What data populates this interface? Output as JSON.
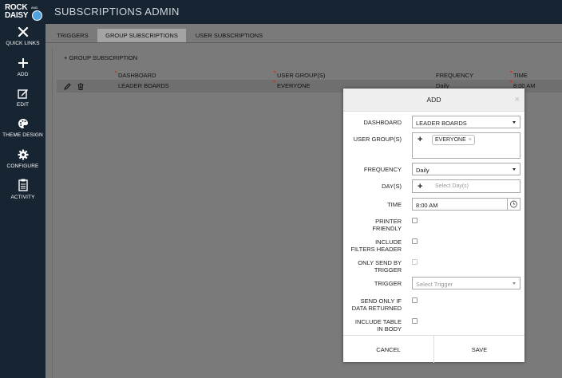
{
  "brand": {
    "line1": "ROCK",
    "line2": "DAISY",
    "and": "AND"
  },
  "header": {
    "title": "SUBSCRIPTIONS ADMIN"
  },
  "sidebar": {
    "items": [
      {
        "label": "QUICK LINKS",
        "icon": "wrench-screwdriver-icon"
      },
      {
        "label": "ADD",
        "icon": "plus-icon"
      },
      {
        "label": "EDIT",
        "icon": "pencil-square-icon"
      },
      {
        "label": "THEME DESIGN",
        "icon": "palette-icon"
      },
      {
        "label": "CONFIGURE",
        "icon": "gear-icon"
      },
      {
        "label": "ACTIVITY",
        "icon": "clipboard-icon"
      }
    ]
  },
  "tabs": [
    {
      "label": "TRIGGERS",
      "active": false
    },
    {
      "label": "GROUP SUBSCRIPTIONS",
      "active": true
    },
    {
      "label": "USER SUBSCRIPTIONS",
      "active": false
    }
  ],
  "panel": {
    "add_label": "+ GROUP SUBSCRIPTION",
    "columns": [
      "DASHBOARD",
      "USER GROUP(S)",
      "FREQUENCY",
      "TIME"
    ],
    "rows": [
      {
        "dashboard": "LEADER BOARDS",
        "user_groups": "EVERYONE",
        "frequency": "Daily",
        "time": "8:00 AM"
      }
    ]
  },
  "modal": {
    "title": "ADD",
    "close": "×",
    "fields": {
      "dashboard": {
        "label": "DASHBOARD",
        "value": "LEADER BOARDS"
      },
      "user_groups": {
        "label": "USER GROUP(S)",
        "chip": "EVERYONE",
        "add": "+"
      },
      "frequency": {
        "label": "FREQUENCY",
        "value": "Daily"
      },
      "days": {
        "label": "DAY(S)",
        "placeholder": "Select Day(s)",
        "add": "+"
      },
      "time": {
        "label": "TIME",
        "value": "8:00 AM"
      },
      "printer_friendly": {
        "label_lines": [
          "PRINTER",
          "FRIENDLY"
        ]
      },
      "include_filters_header": {
        "label_lines": [
          "INCLUDE",
          "FILTERS HEADER"
        ]
      },
      "only_send_by_trigger": {
        "label_lines": [
          "ONLY SEND BY",
          "TRIGGER"
        ]
      },
      "trigger": {
        "label": "TRIGGER",
        "placeholder": "Select Trigger"
      },
      "send_only_if_data": {
        "label_lines": [
          "SEND ONLY IF",
          "DATA RETURNED"
        ]
      },
      "include_table_in_body": {
        "label_lines": [
          "INCLUDE TABLE",
          "IN BODY"
        ]
      }
    },
    "cancel_label": "CANCEL",
    "save_label": "SAVE"
  },
  "colors": {
    "sidebar": "#172432",
    "accent": "#4fa3e0",
    "marker": "#c0392b"
  }
}
